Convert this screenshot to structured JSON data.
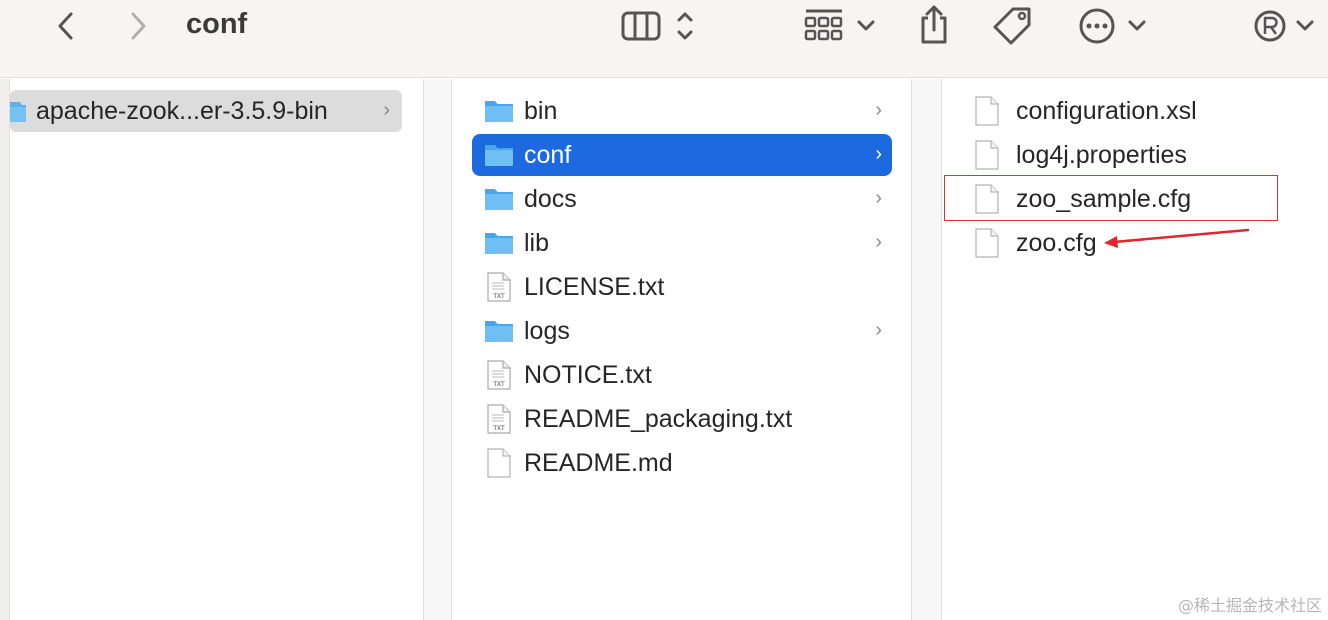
{
  "window": {
    "title": "conf"
  },
  "column1": {
    "items": [
      {
        "label": "apache-zook...er-3.5.9-bin"
      }
    ]
  },
  "column2": {
    "items": [
      {
        "label": "bin",
        "type": "folder"
      },
      {
        "label": "conf",
        "type": "folder"
      },
      {
        "label": "docs",
        "type": "folder"
      },
      {
        "label": "lib",
        "type": "folder"
      },
      {
        "label": "LICENSE.txt",
        "type": "txt"
      },
      {
        "label": "logs",
        "type": "folder"
      },
      {
        "label": "NOTICE.txt",
        "type": "txt"
      },
      {
        "label": "README_packaging.txt",
        "type": "txt"
      },
      {
        "label": "README.md",
        "type": "doc"
      }
    ]
  },
  "column3": {
    "items": [
      {
        "label": "configuration.xsl"
      },
      {
        "label": "log4j.properties"
      },
      {
        "label": "zoo_sample.cfg"
      },
      {
        "label": "zoo.cfg"
      }
    ]
  },
  "icons": {
    "txt_badge": "TXT",
    "chevron": "›"
  },
  "colors": {
    "selection": "#1d6ae0",
    "annotation": "#d9323a",
    "folder": "#5bb2ec"
  },
  "watermark": "@稀土掘金技术社区"
}
